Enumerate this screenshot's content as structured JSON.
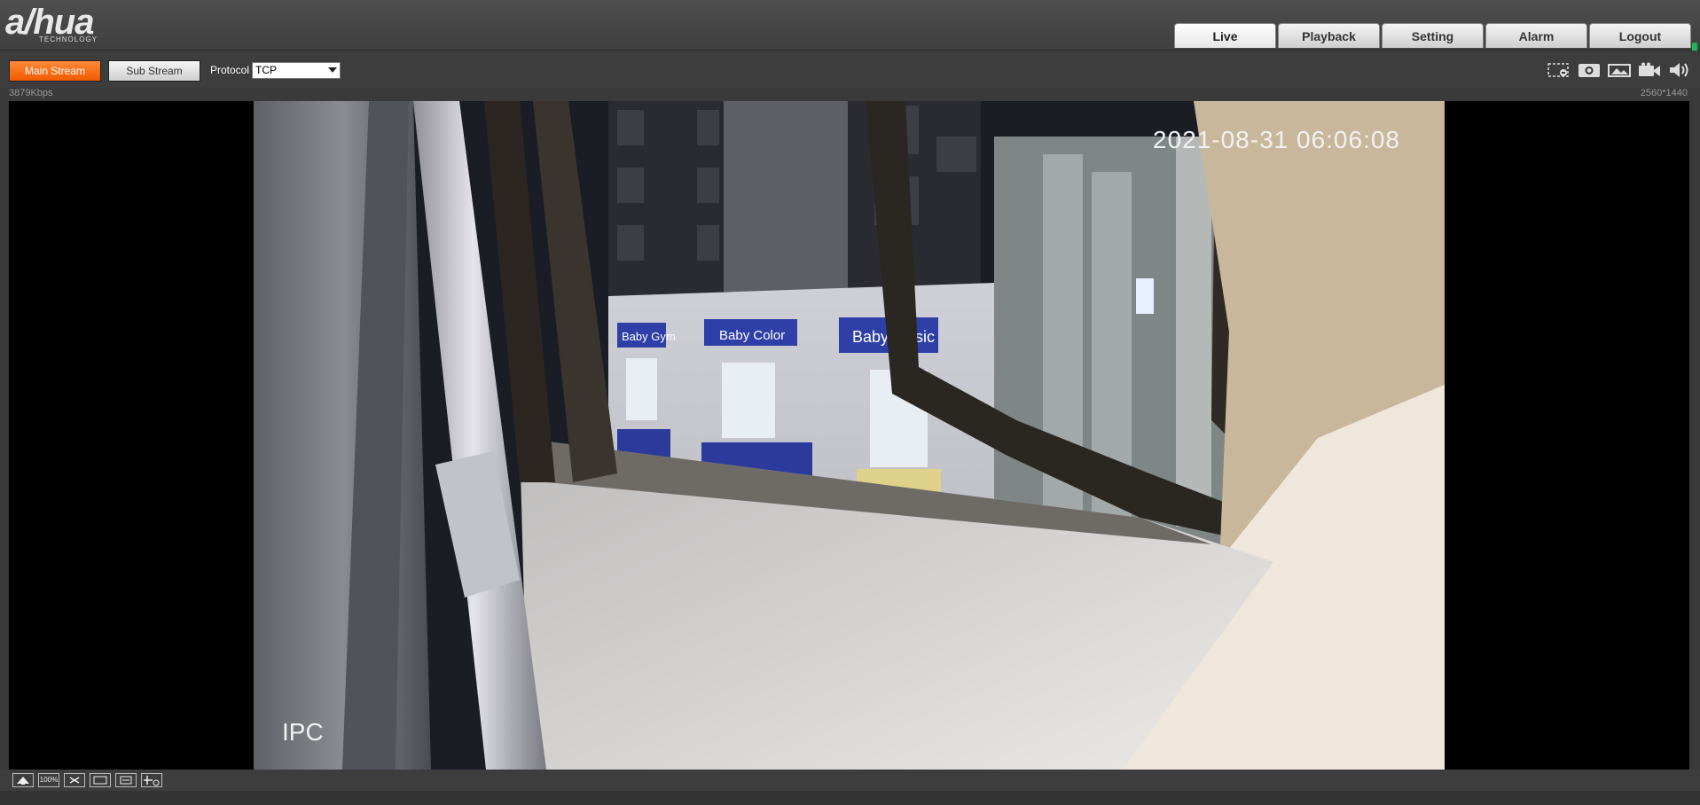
{
  "brand": {
    "name": "a/hua",
    "tagline": "TECHNOLOGY"
  },
  "nav": {
    "tabs": [
      {
        "label": "Live",
        "active": true
      },
      {
        "label": "Playback",
        "active": false
      },
      {
        "label": "Setting",
        "active": false
      },
      {
        "label": "Alarm",
        "active": false
      },
      {
        "label": "Logout",
        "active": false
      }
    ]
  },
  "toolbar": {
    "main_stream_label": "Main Stream",
    "sub_stream_label": "Sub Stream",
    "protocol_label": "Protocol",
    "protocol_value": "TCP",
    "active_stream_color": "#f26a10",
    "icons": [
      "zoom-region-icon",
      "snapshot-icon",
      "triple-snapshot-icon",
      "record-icon",
      "audio-icon"
    ]
  },
  "stream_info": {
    "bitrate": "3879Kbps",
    "resolution": "2560*1440"
  },
  "video": {
    "osd_datetime": "2021-08-31 06:06:08",
    "osd_channel_name": "IPC",
    "signs": [
      "Baby Gym",
      "Baby Color",
      "Baby Music"
    ]
  },
  "bottom_controls": {
    "icons": [
      "fit-window-icon",
      "original-size-icon",
      "fullscreen-icon",
      "wh-ratio-icon",
      "fluency-icon",
      "rule-info-icon"
    ],
    "original_size_label": "100%"
  }
}
